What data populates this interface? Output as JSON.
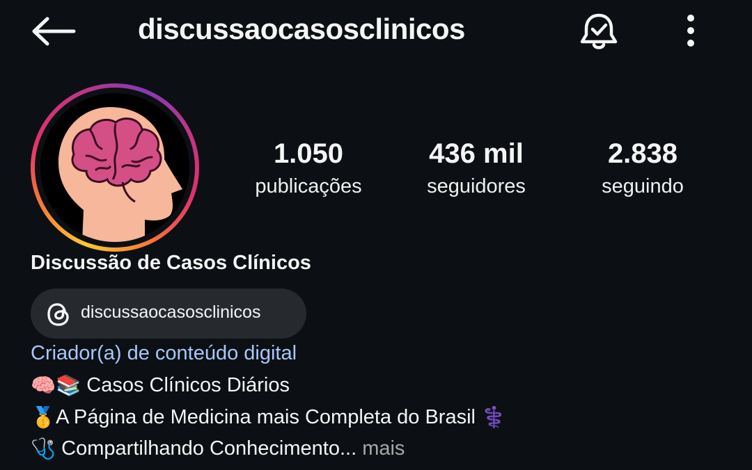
{
  "header": {
    "username": "discussaocasosclinicos",
    "back_icon": "arrow-left-icon",
    "bell_icon": "bell-check-icon",
    "more_icon": "more-vertical-icon"
  },
  "profile": {
    "avatar_icon": "brain-head-icon",
    "ring_colors": [
      "#fdc830",
      "#f77737",
      "#e1306c",
      "#c13584",
      "#833ab4"
    ],
    "display_name": "Discussão de Casos Clínicos",
    "threads_handle": "discussaocasosclinicos",
    "category": "Criador(a) de conteúdo digital"
  },
  "stats": [
    {
      "value": "1.050",
      "label": "publicações"
    },
    {
      "value": "436 mil",
      "label": "seguidores"
    },
    {
      "value": "2.838",
      "label": "seguindo"
    }
  ],
  "bio": {
    "line1_emoji": "🧠📚",
    "line1_text": "Casos Clínicos Diários",
    "line2_emoji": "🥇",
    "line2_text": "A Página de Medicina mais Completa do Brasil",
    "line2_trailing_emoji": "⚕️",
    "line3_emoji": "🩺",
    "line3_text": "Compartilhando Conhecimento...",
    "more_label": "mais"
  },
  "colors": {
    "background": "#0c1014",
    "link": "#a8c7fa",
    "chip": "#262a2f",
    "muted": "#a8a8a8"
  }
}
